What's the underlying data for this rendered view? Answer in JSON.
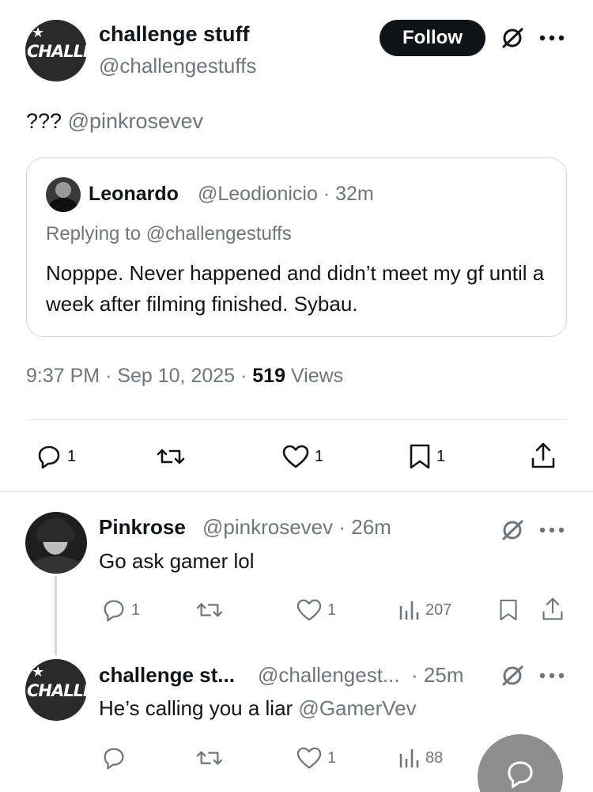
{
  "post": {
    "author_name": "challenge stuff",
    "author_handle": "@challengestuffs",
    "avatar_text": "CHALLE",
    "follow_label": "Follow",
    "text_prefix": "???",
    "text_mention": "@pinkrosevev",
    "quote": {
      "name": "Leonardo",
      "meta": "@Leodionicio · 32m",
      "replying_prefix": "Replying to ",
      "replying_handle": "@challengestuffs",
      "body": "Nopppe. Never happened and didn’t meet my gf until a week after filming finished. Sybau."
    },
    "timestamp": "9:37 PM · Sep 10, 2025 · ",
    "views_count": "519",
    "views_label": " Views",
    "actions": {
      "replies": "1",
      "reposts": "",
      "likes": "1",
      "bookmarks": "1"
    }
  },
  "replies": [
    {
      "name": "Pinkrose",
      "meta": "@pinkrosevev · 26m",
      "body": "Go ask gamer lol",
      "replies": "1",
      "reposts": "",
      "likes": "1",
      "views": "207"
    },
    {
      "name": "challenge st...",
      "meta": "@challengest...  · 25m",
      "body_prefix": "He’s calling you a liar ",
      "body_mention": "@GamerVev",
      "replies": "",
      "reposts": "",
      "likes": "1",
      "views": "88"
    }
  ],
  "colors": {
    "text": "#0f1419",
    "secondary": "#6e767d",
    "border": "#d0d5d9",
    "fab": "#8e8e8e"
  }
}
